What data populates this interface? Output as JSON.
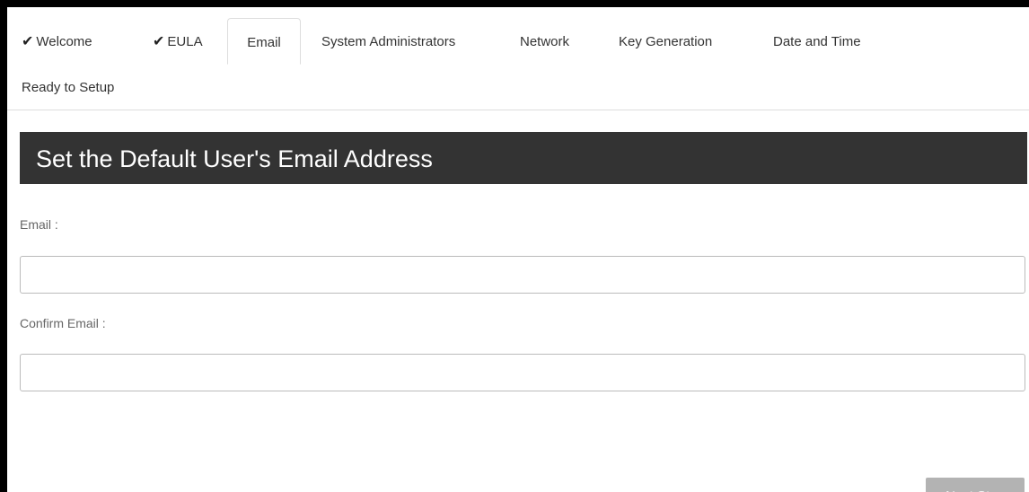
{
  "tabs": {
    "welcome": "Welcome",
    "eula": "EULA",
    "email": "Email",
    "system_administrators": "System Administrators",
    "network": "Network",
    "key_generation": "Key Generation",
    "date_and_time": "Date and Time",
    "ready_to_setup": "Ready to Setup",
    "check_glyph": "✔"
  },
  "heading": {
    "title": "Set the Default User's Email Address"
  },
  "form": {
    "email_label": "Email :",
    "email_value": "",
    "confirm_email_label": "Confirm Email :",
    "confirm_email_value": ""
  },
  "actions": {
    "next_step": "Next Step"
  },
  "icons": {
    "completed": "check-icon"
  },
  "colors": {
    "heading_bg": "#333333",
    "next_button_disabled_bg": "#b3b3b3",
    "frame": "#000000"
  }
}
